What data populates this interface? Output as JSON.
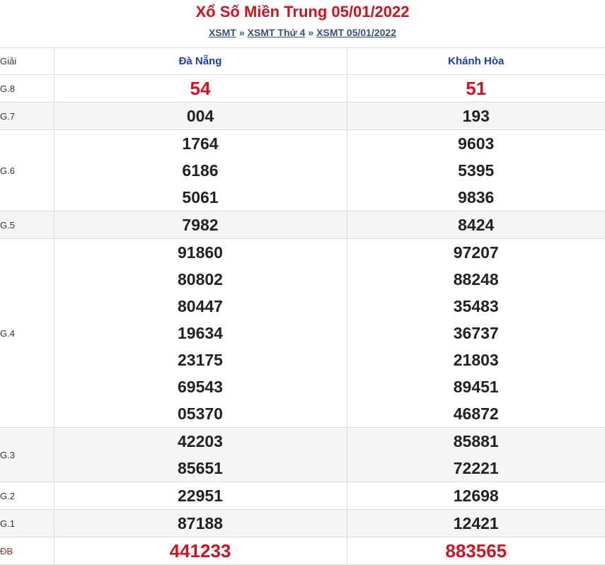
{
  "header": {
    "title": "Xổ Số Miền Trung 05/01/2022",
    "breadcrumb": {
      "link1": "XSMT",
      "sep1": "»",
      "link2": "XSMT Thứ 4",
      "sep2": "»",
      "link3": "XSMT 05/01/2022"
    }
  },
  "table": {
    "label_header": "Giải",
    "provinces": [
      "Đà Nẵng",
      "Khánh Hòa"
    ],
    "rows": [
      {
        "label": "G.8",
        "a": [
          "54"
        ],
        "b": [
          "51"
        ]
      },
      {
        "label": "G.7",
        "a": [
          "004"
        ],
        "b": [
          "193"
        ]
      },
      {
        "label": "G.6",
        "a": [
          "1764",
          "6186",
          "5061"
        ],
        "b": [
          "9603",
          "5395",
          "9836"
        ]
      },
      {
        "label": "G.5",
        "a": [
          "7982"
        ],
        "b": [
          "8424"
        ]
      },
      {
        "label": "G.4",
        "a": [
          "91860",
          "80802",
          "80447",
          "19634",
          "23175",
          "69543",
          "05370"
        ],
        "b": [
          "97207",
          "88248",
          "35483",
          "36737",
          "21803",
          "89451",
          "46872"
        ]
      },
      {
        "label": "G.3",
        "a": [
          "42203",
          "85651"
        ],
        "b": [
          "85881",
          "72221"
        ]
      },
      {
        "label": "G.2",
        "a": [
          "22951"
        ],
        "b": [
          "12698"
        ]
      },
      {
        "label": "G.1",
        "a": [
          "87188"
        ],
        "b": [
          "12421"
        ]
      },
      {
        "label": "ĐB",
        "a": [
          "441233"
        ],
        "b": [
          "883565"
        ]
      }
    ]
  },
  "colors": {
    "accent_red": "#d4111e",
    "province_blue": "#1a3ea8",
    "link_blue": "#3a4f7a"
  }
}
